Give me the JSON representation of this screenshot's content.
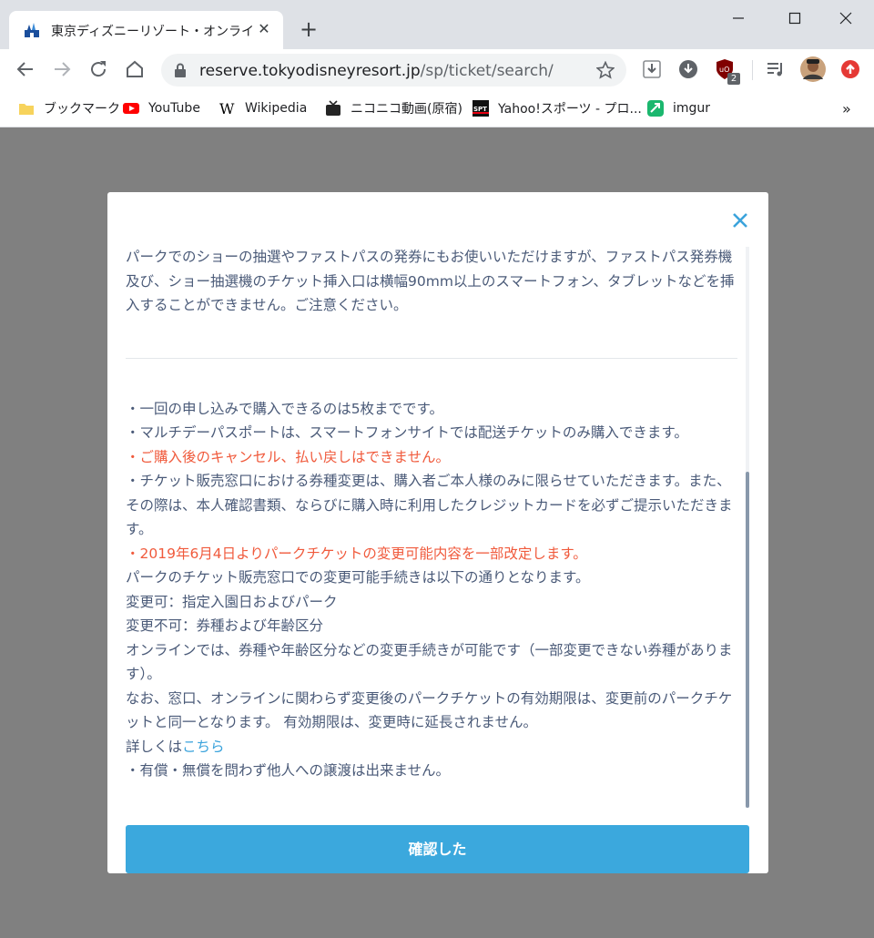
{
  "browser": {
    "tab": {
      "title": "東京ディズニーリゾート・オンライン予約"
    },
    "url": {
      "host": "reserve.tokyodisneyresort.jp",
      "path": "/sp/ticket/search/"
    },
    "extensions": {
      "ublock_badge": "2"
    },
    "bookmarks": [
      {
        "label": "ブックマーク",
        "icon": "folder-icon"
      },
      {
        "label": "YouTube",
        "icon": "youtube-icon"
      },
      {
        "label": "Wikipedia",
        "icon": "wikipedia-icon"
      },
      {
        "label": "ニコニコ動画(原宿)",
        "icon": "niconico-icon"
      },
      {
        "label": "Yahoo!スポーツ - プロ...",
        "icon": "yahoo-sports-icon"
      },
      {
        "label": "imgur",
        "icon": "imgur-icon"
      }
    ],
    "more_bookmarks": "»"
  },
  "modal": {
    "intro": "パークでのショーの抽選やファストパスの発券にもお使いいただけますが、ファストパス発券機及び、ショー抽選機のチケット挿入口は横幅90mm以上のスマートフォン、タブレットなどを挿入することができません。ご注意ください。",
    "notes": [
      "・一回の申し込みで購入できるのは5枚までです。",
      "・マルチデーパスポートは、スマートフォンサイトでは配送チケットのみ購入できます。",
      "・ご購入後のキャンセル、払い戻しはできません。",
      "・チケット販売窓口における券種変更は、購入者ご本人様のみに限らせていただきます。また、その際は、本人確認書類、ならびに購入時に利用したクレジットカードを必ずご提示いただきます。",
      "・2019年6月4日よりパークチケットの変更可能内容を一部改定します。",
      "パークのチケット販売窓口での変更可能手続きは以下の通りとなります。",
      "変更可：指定入園日およびパーク",
      "変更不可：券種および年齢区分",
      "オンラインでは、券種や年齢区分などの変更手続きが可能です（一部変更できない券種があります）。",
      "なお、窓口、オンラインに関わらず変更後のパークチケットの有効期限は、変更前のパークチケットと同一となります。 有効期限は、変更時に延長されません。"
    ],
    "details_prefix": "詳しくは",
    "details_link": "こちら",
    "last_note": "・有償・無償を問わず他人への譲渡は出来ません。",
    "confirm_button": "確認した",
    "colors": {
      "text": "#4a5a78",
      "alert": "#f05a3c",
      "link": "#3ba3dc",
      "button": "#3ba8dd"
    }
  }
}
